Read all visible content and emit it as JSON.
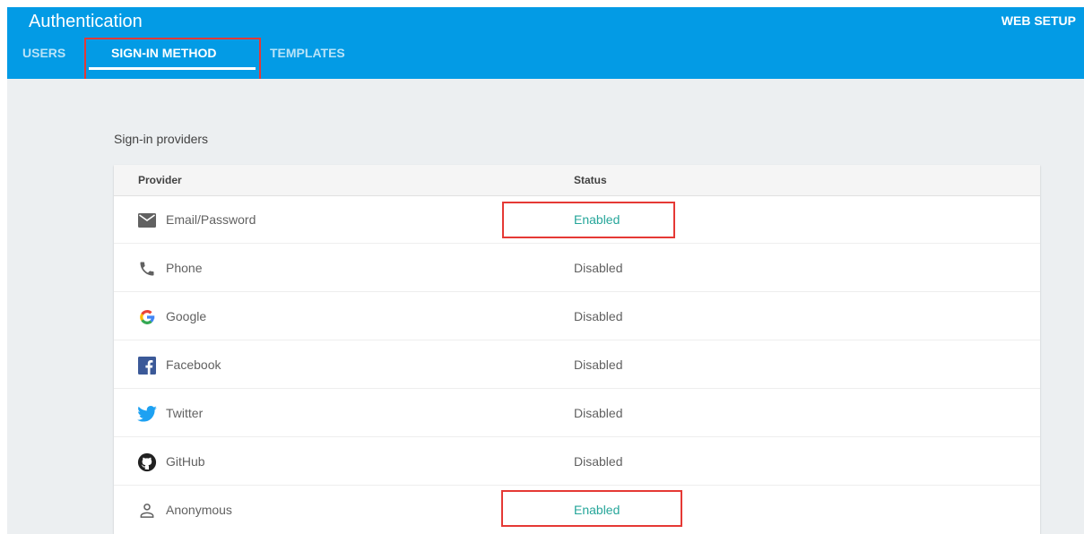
{
  "header": {
    "title": "Authentication",
    "web_setup_label": "WEB SETUP",
    "tabs": [
      {
        "label": "USERS"
      },
      {
        "label": "SIGN-IN METHOD"
      },
      {
        "label": "TEMPLATES"
      }
    ],
    "active_tab": "SIGN-IN METHOD",
    "background_color": "#039be5"
  },
  "section_title": "Sign-in providers",
  "table": {
    "columns": [
      "Provider",
      "Status"
    ],
    "rows": [
      {
        "provider": "Email/Password",
        "status": "Enabled",
        "icon": "email-icon"
      },
      {
        "provider": "Phone",
        "status": "Disabled",
        "icon": "phone-icon"
      },
      {
        "provider": "Google",
        "status": "Disabled",
        "icon": "google-icon"
      },
      {
        "provider": "Facebook",
        "status": "Disabled",
        "icon": "facebook-icon"
      },
      {
        "provider": "Twitter",
        "status": "Disabled",
        "icon": "twitter-icon"
      },
      {
        "provider": "GitHub",
        "status": "Disabled",
        "icon": "github-icon"
      },
      {
        "provider": "Anonymous",
        "status": "Enabled",
        "icon": "anonymous-icon"
      }
    ]
  },
  "colors": {
    "enabled_text": "#26a69a",
    "highlight_box": "#e53935"
  }
}
